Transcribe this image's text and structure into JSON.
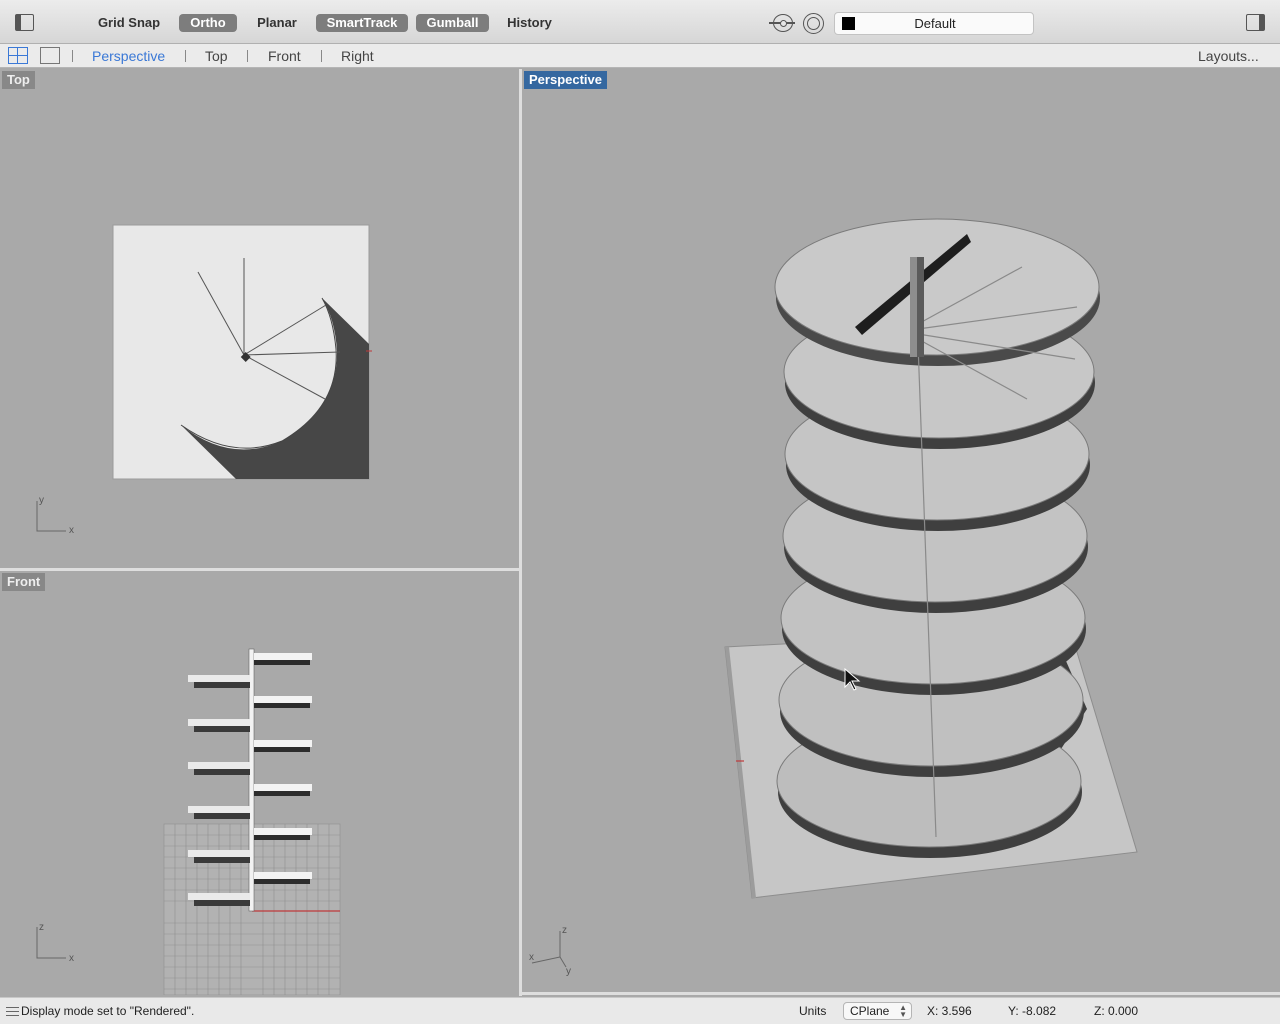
{
  "toolbar": {
    "left_panel_icon": "sidebar-left-icon",
    "toggles": {
      "grid_snap": "Grid Snap",
      "ortho": "Ortho",
      "planar": "Planar",
      "smarttrack": "SmartTrack",
      "gumball": "Gumball",
      "history": "History"
    },
    "active_toggles": [
      "Ortho",
      "SmartTrack",
      "Gumball"
    ],
    "osnap_icon": "osnap-icon",
    "record_icon": "record-history-icon",
    "layer": {
      "name": "Default",
      "color": "#000000"
    },
    "right_panel_icon": "sidebar-right-icon"
  },
  "tabbar": {
    "tabs": [
      "Perspective",
      "Top",
      "Front",
      "Right"
    ],
    "active_tab": "Perspective",
    "layouts_label": "Layouts..."
  },
  "viewports": {
    "top": {
      "title": "Top",
      "axis_a": "y",
      "axis_b": "x"
    },
    "front": {
      "title": "Front",
      "axis_a": "z",
      "axis_b": "x"
    },
    "perspective": {
      "title": "Perspective",
      "axis_z": "z",
      "axis_x": "x",
      "axis_y": "y"
    }
  },
  "colors": {
    "viewport_bg": "#a9a9a9",
    "active_label": "#3568a0",
    "active_tab": "#3a78d6",
    "x_axis": "#c0393b"
  },
  "statusbar": {
    "message": "Display mode set to \"Rendered\".",
    "units_label": "Units",
    "cplane_label": "CPlane",
    "x": "X: 3.596",
    "y": "Y: -8.082",
    "z": "Z: 0.000"
  }
}
